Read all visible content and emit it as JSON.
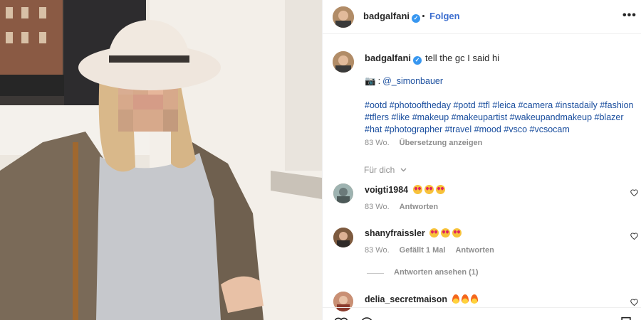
{
  "post": {
    "author": "badgalfani",
    "follow_label": "Folgen",
    "more_label": "•••",
    "caption": "tell the gc I said hi",
    "credit_icon": "📷",
    "credit_mention": "@_simonbauer",
    "hashtags": [
      "#ootd",
      "#photooftheday",
      "#potd",
      "#tfl",
      "#leica",
      "#camera",
      "#instadaily",
      "#fashion",
      "#tflers",
      "#like",
      "#makeup",
      "#makeupartist",
      "#wakeupandmakeup",
      "#blazer",
      "#hat",
      "#photographer",
      "#travel",
      "#mood",
      "#vsco",
      "#vcsocam"
    ],
    "age": "83 Wo.",
    "translate_label": "Übersetzung anzeigen"
  },
  "filter_label": "Für dich",
  "comments": [
    {
      "user": "voigti1984",
      "emoji": [
        "heart-eyes",
        "heart-eyes",
        "heart-eyes"
      ],
      "age": "83 Wo.",
      "reply_label": "Antworten"
    },
    {
      "user": "shanyfraissler",
      "emoji": [
        "heart-eyes",
        "heart-eyes",
        "heart-eyes"
      ],
      "age": "83 Wo.",
      "likes_label": "Gefällt 1 Mal",
      "reply_label": "Antworten",
      "view_replies_label": "Antworten ansehen (1)"
    },
    {
      "user": "delia_secretmaison",
      "emoji": [
        "fire",
        "fire",
        "fire"
      ]
    }
  ],
  "colors": {
    "link": "#1a4e9e",
    "follow": "#3c6ecf",
    "verified": "#3897f0",
    "meta": "#8e8e8e"
  },
  "icons": {
    "verified": "verified-badge-icon",
    "like": "heart-outline-icon",
    "camera": "camera-emoji-icon"
  }
}
